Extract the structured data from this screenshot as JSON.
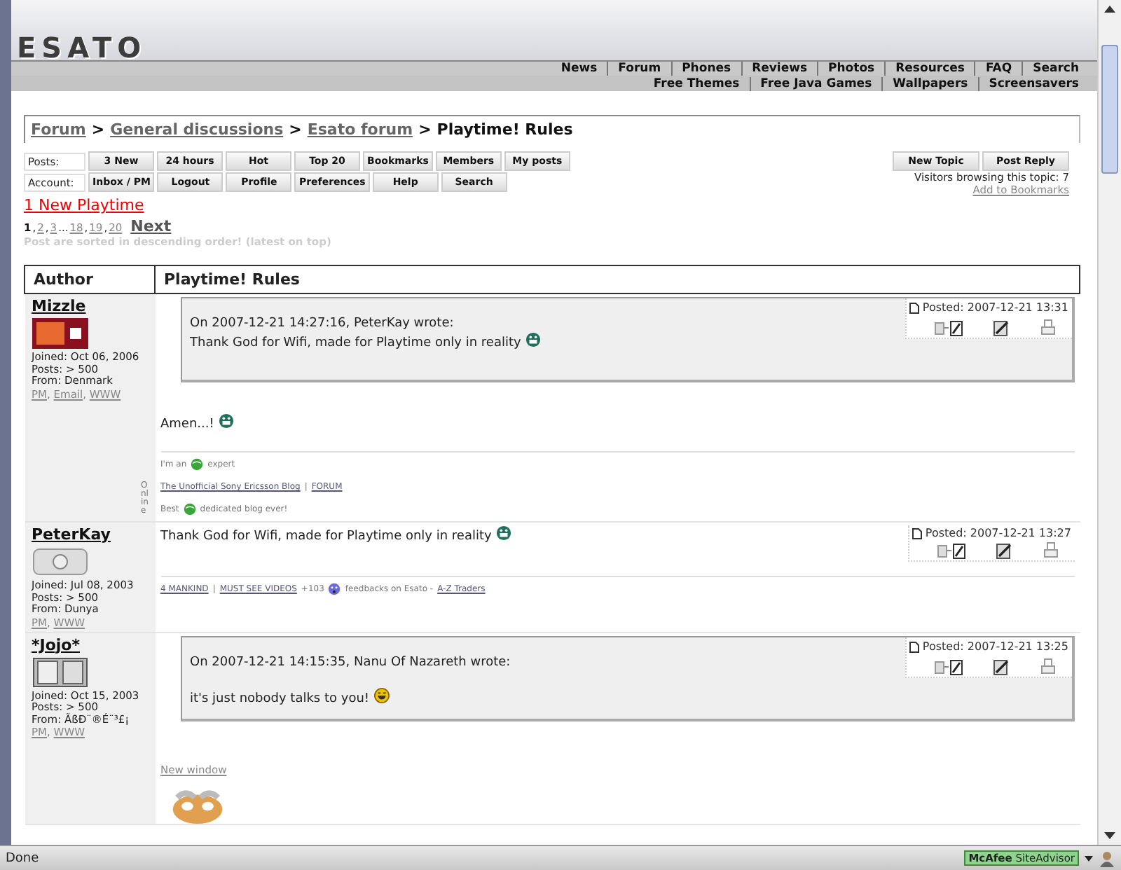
{
  "header": {
    "logo": "ESATO",
    "nav_row1": [
      "News",
      "Forum",
      "Phones",
      "Reviews",
      "Photos",
      "Resources",
      "FAQ",
      "Search"
    ],
    "nav_row2": [
      "Free Themes",
      "Free Java Games",
      "Wallpapers",
      "Screensavers"
    ]
  },
  "breadcrumb_separator": ">",
  "link_separator": ",",
  "breadcrumb": [
    {
      "label": "Forum",
      "link": true
    },
    {
      "label": "General discussions",
      "link": true
    },
    {
      "label": "Esato forum",
      "link": true
    },
    {
      "label": "Playtime! Rules",
      "link": false
    }
  ],
  "posts_bar": {
    "label": "Posts:",
    "buttons": [
      "3 New",
      "24 hours",
      "Hot",
      "Top 20",
      "Bookmarks",
      "Members",
      "My posts"
    ]
  },
  "account_bar": {
    "label": "Account:",
    "buttons": [
      "Inbox / PM",
      "Logout",
      "Profile",
      "Preferences",
      "Help",
      "Search"
    ]
  },
  "topic_buttons": [
    "New Topic",
    "Post Reply"
  ],
  "visitors": "Visitors browsing this topic: 7",
  "add_bookmarks": "Add to Bookmarks",
  "new_link": "1 New Playtime",
  "pagination": [
    {
      "kind": "page",
      "label": "1",
      "selected": true
    },
    {
      "kind": "text",
      "label": ","
    },
    {
      "kind": "page",
      "label": "2",
      "selected": false
    },
    {
      "kind": "text",
      "label": ","
    },
    {
      "kind": "page",
      "label": "3",
      "selected": false
    },
    {
      "kind": "text",
      "label": "..."
    },
    {
      "kind": "page",
      "label": "18",
      "selected": false
    },
    {
      "kind": "text",
      "label": ","
    },
    {
      "kind": "page",
      "label": "19",
      "selected": false
    },
    {
      "kind": "text",
      "label": ","
    },
    {
      "kind": "page",
      "label": "20",
      "selected": false
    },
    {
      "kind": "next",
      "label": "Next"
    }
  ],
  "sort_note": "Post are sorted in descending order! (latest on top)",
  "table": {
    "columns": [
      "Author",
      "Playtime! Rules"
    ]
  },
  "posts": [
    {
      "author": "Mizzle",
      "avatar": {
        "kind": "red"
      },
      "joined": "Joined: Oct 06, 2006",
      "post_count": "Posts: > 500",
      "from": "From: Denmark",
      "links": [
        "PM",
        "Email",
        "WWW"
      ],
      "online": "Online",
      "posted": "Posted: 2007-12-21 13:31",
      "quote": {
        "header": "On 2007-12-21 14:27:16, PeterKay wrote:",
        "text": "Thank God for Wifi, made for Playtime only in reality",
        "smiley": {
          "kind": "grin"
        }
      },
      "body": "Amen...!",
      "body_smiley": {
        "kind": "grin"
      },
      "signature": [
        [
          {
            "kind": "text",
            "text": "I'm an"
          },
          {
            "kind": "logo"
          },
          {
            "kind": "text",
            "text": "expert"
          }
        ],
        [
          {
            "kind": "link",
            "text": "The Unofficial Sony Ericsson Blog"
          },
          {
            "kind": "text",
            "text": "|"
          },
          {
            "kind": "link",
            "text": "FORUM"
          }
        ],
        [
          {
            "kind": "text",
            "text": "Best"
          },
          {
            "kind": "logo"
          },
          {
            "kind": "text",
            "text": "dedicated blog ever!"
          }
        ]
      ]
    },
    {
      "author": "PeterKay",
      "avatar": {
        "kind": "silver"
      },
      "joined": "Joined: Jul 08, 2003",
      "post_count": "Posts: > 500",
      "from": "From: Dunya",
      "links": [
        "PM",
        "WWW"
      ],
      "posted": "Posted: 2007-12-21 13:27",
      "body": "Thank God for Wifi, made for Playtime only in reality",
      "body_smiley": {
        "kind": "grin"
      },
      "signature": [
        [
          {
            "kind": "link",
            "text": "4 MANKIND"
          },
          {
            "kind": "text",
            "text": "|"
          },
          {
            "kind": "link",
            "text": "MUST SEE VIDEOS"
          },
          {
            "kind": "text",
            "text": "+103"
          },
          {
            "kind": "sad"
          },
          {
            "kind": "text",
            "text": "feedbacks on Esato -"
          },
          {
            "kind": "link",
            "text": "A-Z Traders"
          }
        ]
      ]
    },
    {
      "author": "*Jojo*",
      "avatar": {
        "kind": "phone"
      },
      "joined": "Joined: Oct 15, 2003",
      "post_count": "Posts: > 500",
      "from": "From: ÃßÐ¨®É¨³£¡",
      "links": [
        "PM",
        "WWW"
      ],
      "posted": "Posted: 2007-12-21 13:25",
      "quote": {
        "header": "On 2007-12-21 14:15:35, Nanu Of Nazareth wrote:",
        "text": "it's just nobody talks to you!",
        "smiley": {
          "kind": "laugh"
        }
      },
      "new_window": "New window"
    }
  ],
  "status_bar": {
    "text": "Done",
    "addon": "**McAfee** SiteAdvisor"
  }
}
